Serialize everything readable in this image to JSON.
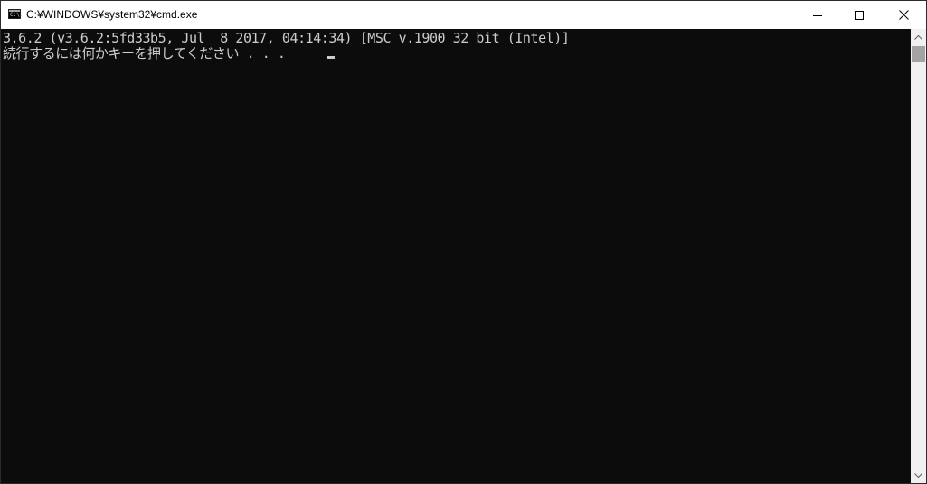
{
  "window": {
    "title": "C:¥WINDOWS¥system32¥cmd.exe",
    "icon": "cmd-icon",
    "icon_text": "C:\\.",
    "controls": [
      "minimize-icon",
      "maximize-icon",
      "close-icon"
    ]
  },
  "console": {
    "lines": [
      "3.6.2 (v3.6.2:5fd33b5, Jul  8 2017, 04:14:34) [MSC v.1900 32 bit (Intel)]",
      "続行するには何かキーを押してください . . . "
    ]
  },
  "colors": {
    "background": "#0c0c0c",
    "text": "#cccccc",
    "titlebar": "#ffffff",
    "scrollbar": "#f0f0f0",
    "thumb": "#a3a3a3"
  }
}
